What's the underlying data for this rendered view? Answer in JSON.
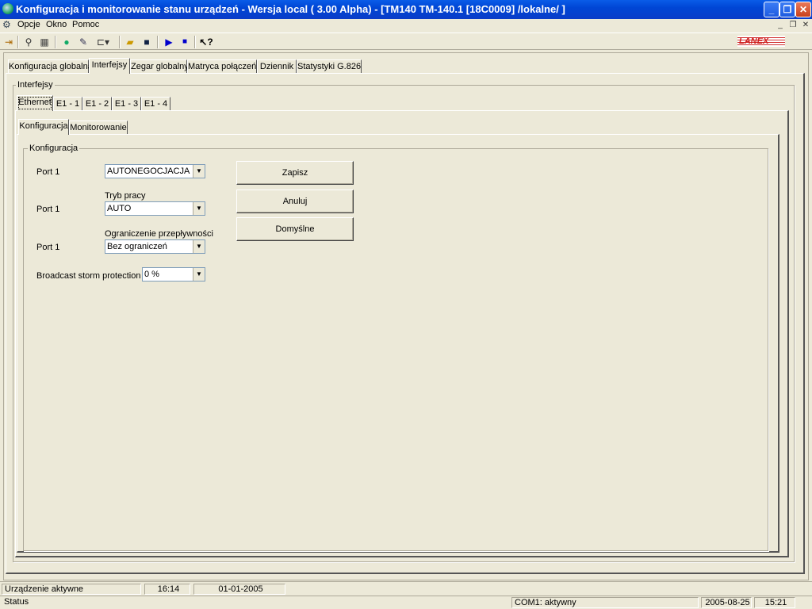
{
  "window": {
    "title": "Konfiguracja i monitorowanie stanu urządzeń  - Wersja local  ( 3.00 Alpha) - [TM140 TM-140.1 [18C0009] /lokalne/ ]",
    "minimize": "_",
    "restore": "❐",
    "close": "✕"
  },
  "menu": {
    "items": [
      "Opcje",
      "Okno",
      "Pomoc"
    ]
  },
  "toolbar": {
    "icons": [
      "exit-icon",
      "search-icon",
      "calculator-icon",
      "globe-icon",
      "edit-icon",
      "dropdown-tool-icon",
      "open-folder-icon",
      "save-icon",
      "play-icon",
      "stop-icon",
      "help-icon"
    ],
    "brand": "LANEX"
  },
  "main_tabs": [
    "Konfiguracja globalna",
    "Interfejsy",
    "Zegar globalny",
    "Matryca połączeń",
    "Dziennik",
    "Statystyki G.826"
  ],
  "interfaces": {
    "group_title": "Interfejsy",
    "tabs": [
      "Ethernet",
      "E1 - 1",
      "E1 - 2",
      "E1 - 3",
      "E1 - 4"
    ]
  },
  "sub_tabs": [
    "Konfiguracja",
    "Monitorowanie"
  ],
  "config": {
    "group_title": "Konfiguracja",
    "port1_label": "Port 1",
    "port1_value": "AUTONEGOCJACJA",
    "tryb_label": "Tryb pracy",
    "port2_label": "Port 1",
    "port2_value": "AUTO",
    "ogr_label": "Ograniczenie przepływności",
    "port3_label": "Port 1",
    "port3_value": "Bez ograniczeń",
    "broadcast_label": "Broadcast storm protection",
    "broadcast_value": "0 %",
    "buttons": {
      "save": "Zapisz",
      "cancel": "Anuluj",
      "default": "Domyślne"
    }
  },
  "status_inner": {
    "state": "Urządzenie aktywne",
    "time": "16:14",
    "date": "01-01-2005"
  },
  "status_outer": {
    "label": "Status",
    "port": "COM1: aktywny",
    "date": "2005-08-25",
    "time": "15:21"
  }
}
